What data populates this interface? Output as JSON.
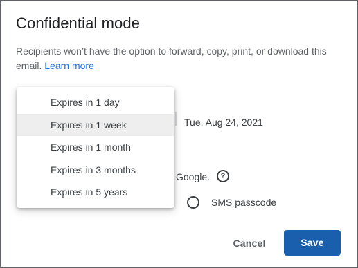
{
  "dialog": {
    "title": "Confidential mode",
    "description": "Recipients won’t have the option to forward, copy, print, or download this email.",
    "learn_more": "Learn more",
    "expiry_date": "Tue, Aug 24, 2021",
    "google_text": "Google.",
    "help_icon": "?",
    "sms_label": "SMS passcode",
    "cancel_label": "Cancel",
    "save_label": "Save"
  },
  "menu": {
    "items": [
      {
        "label": "Expires in 1 day",
        "selected": false
      },
      {
        "label": "Expires in 1 week",
        "selected": true
      },
      {
        "label": "Expires in 1 month",
        "selected": false
      },
      {
        "label": "Expires in 3 months",
        "selected": false
      },
      {
        "label": "Expires in 5 years",
        "selected": false
      }
    ]
  },
  "colors": {
    "accent": "#1a5fad",
    "link": "#1a73e8",
    "text": "#3c4043",
    "selected_bg": "#eeeeee"
  }
}
